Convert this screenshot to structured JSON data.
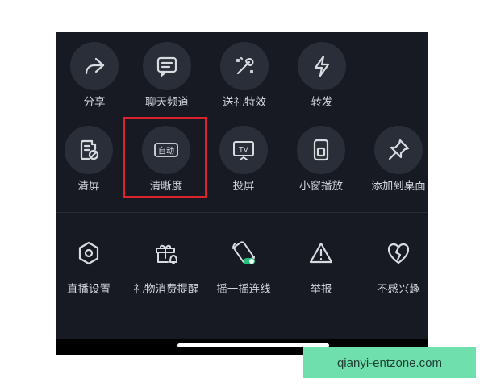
{
  "rows": {
    "row1": [
      {
        "label": "分享",
        "icon": "share-icon"
      },
      {
        "label": "聊天频道",
        "icon": "chat-channel-icon"
      },
      {
        "label": "送礼特效",
        "icon": "gift-effect-icon"
      },
      {
        "label": "转发",
        "icon": "lightning-icon"
      }
    ],
    "row2": [
      {
        "label": "清屏",
        "icon": "clear-screen-icon"
      },
      {
        "label": "清晰度",
        "icon": "resolution-icon",
        "badge": "自动"
      },
      {
        "label": "投屏",
        "icon": "tv-cast-icon",
        "badge": "TV"
      },
      {
        "label": "小窗播放",
        "icon": "mini-window-icon"
      },
      {
        "label": "添加到桌面",
        "icon": "pin-icon"
      }
    ],
    "row3": [
      {
        "label": "直播设置",
        "icon": "settings-hexagon-icon"
      },
      {
        "label": "礼物消费提醒",
        "icon": "gift-bell-icon"
      },
      {
        "label": "摇一摇连线",
        "icon": "shake-connect-icon"
      },
      {
        "label": "举报",
        "icon": "warning-icon"
      },
      {
        "label": "不感兴趣",
        "icon": "broken-heart-icon"
      }
    ]
  },
  "watermark": "qianyi-entzone.com",
  "colors": {
    "panel": "#171a22",
    "circle": "#2a2e38",
    "text": "#cfd3da",
    "highlight": "#d9232d",
    "watermark": "#6fe0ad"
  }
}
